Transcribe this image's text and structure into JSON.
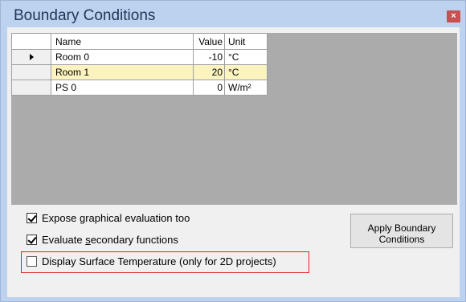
{
  "window": {
    "title": "Boundary Conditions",
    "close_glyph": "×"
  },
  "grid": {
    "columns": {
      "name": "Name",
      "value": "Value",
      "unit": "Unit"
    },
    "rows": [
      {
        "name": "Room 0",
        "value": "-10",
        "unit": "°C",
        "current": true
      },
      {
        "name": "Room 1",
        "value": "20",
        "unit": "°C",
        "highlighted": true
      },
      {
        "name": "PS 0",
        "value": "0",
        "unit": "W/m²"
      }
    ]
  },
  "options": {
    "expose_graphical": {
      "label_pre": "Expose ",
      "label_key": "g",
      "label_post": "raphical evaluation too",
      "checked": true
    },
    "evaluate_secondary": {
      "label_pre": "Evaluate ",
      "label_key": "s",
      "label_post": "econdary functions",
      "checked": true
    },
    "display_surface_temp": {
      "label": "Display Surface Temperature (only for 2D projects)",
      "checked": false
    }
  },
  "apply_button": {
    "line1": "Apply Boundary",
    "line2": "Conditions"
  },
  "colors": {
    "title_bar": "#bcd2ee",
    "highlight_row": "#fbf3c0",
    "close_button": "#c75050",
    "grid_background": "#ababab",
    "callout_frame": "#e02020"
  }
}
